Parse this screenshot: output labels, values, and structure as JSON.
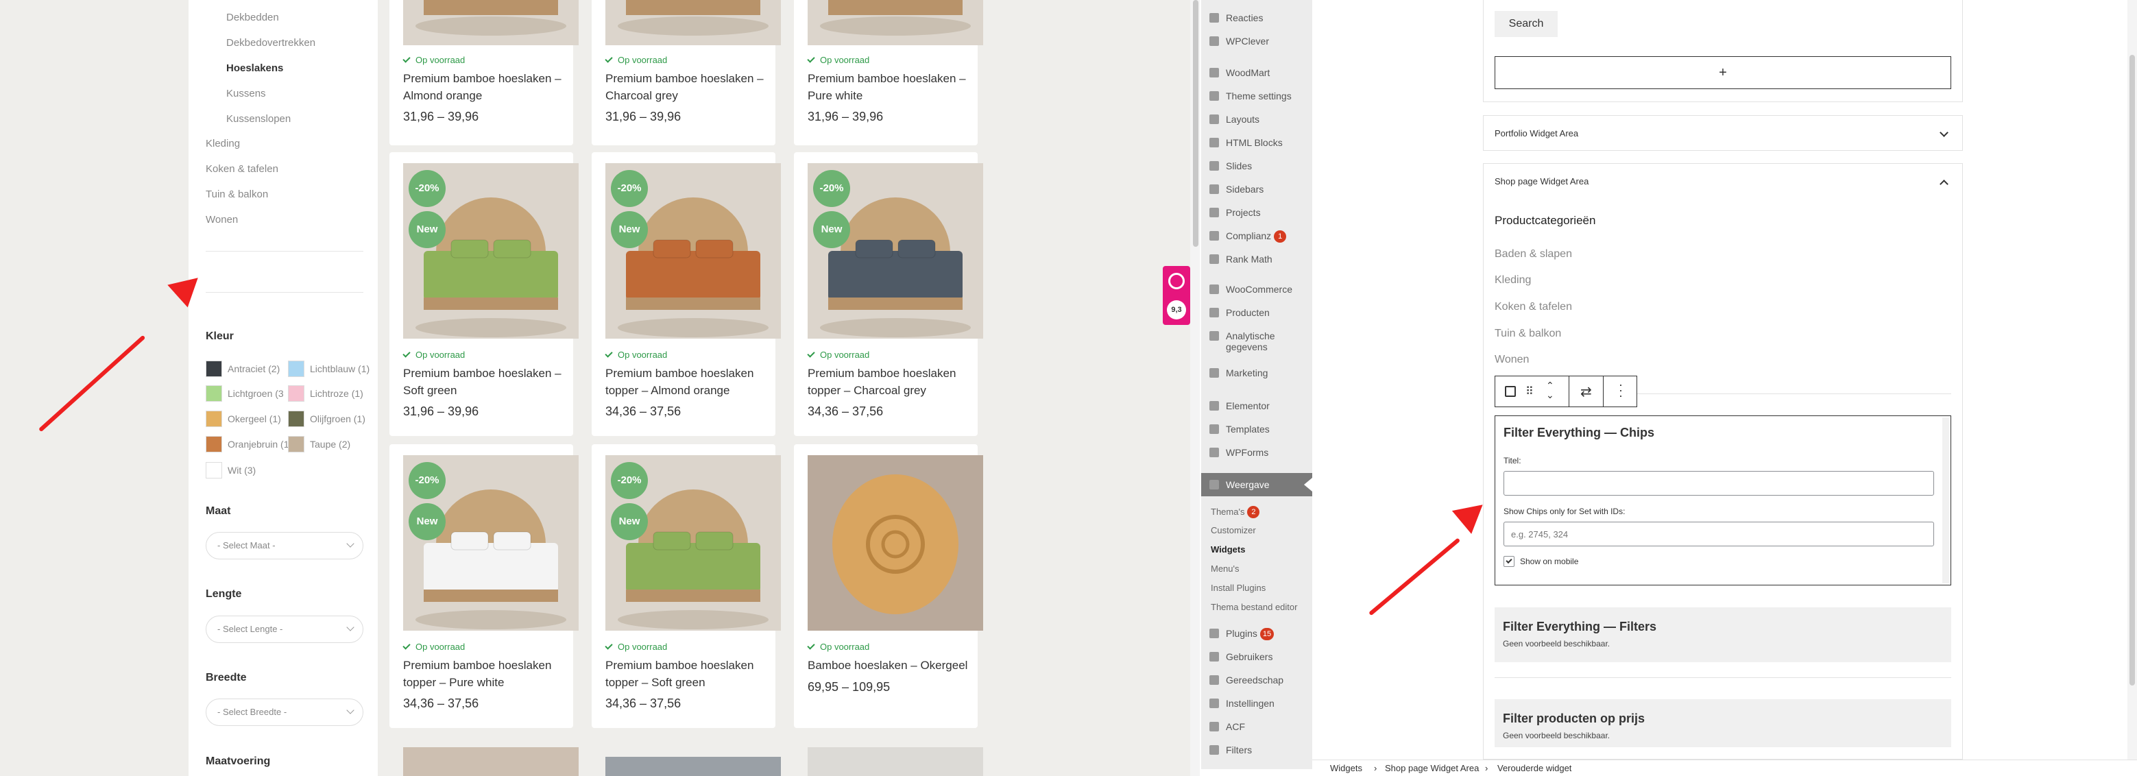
{
  "shop": {
    "subcategories": [
      "Dekbedden",
      "Dekbedovertrekken",
      "Hoeslakens",
      "Kussens",
      "Kussenslopen"
    ],
    "active_subcategory": "Hoeslakens",
    "categories": [
      "Kleding",
      "Koken & tafelen",
      "Tuin & balkon",
      "Wonen"
    ],
    "filters": {
      "color_title": "Kleur",
      "colors": [
        {
          "label": "Antraciet (2)",
          "color": "#3a3f44"
        },
        {
          "label": "Lichtblauw (1)",
          "color": "#a9d6f2"
        },
        {
          "label": "Lichtgroen (3",
          "color": "#a9d98b"
        },
        {
          "label": "Lichtroze (1)",
          "color": "#f6c1d0"
        },
        {
          "label": "Okergeel (1)",
          "color": "#e3b061"
        },
        {
          "label": "Olijfgroen (1)",
          "color": "#6b6d4f"
        },
        {
          "label": "Oranjebruin (1",
          "color": "#c97d44"
        },
        {
          "label": "Taupe (2)",
          "color": "#c3b19a"
        },
        {
          "label": "Wit (3)",
          "color": "#ffffff"
        }
      ],
      "maat_title": "Maat",
      "maat_placeholder": "- Select Maat -",
      "lengte_title": "Lengte",
      "lengte_placeholder": "- Select Lengte -",
      "breedte_title": "Breedte",
      "breedte_placeholder": "- Select Breedte -",
      "maatvoering_title": "Maatvoering"
    },
    "products": [
      {
        "name": "Premium bamboe hoeslaken – Almond orange",
        "price": "31,96 – 39,96",
        "stock": "Op voorraad",
        "badges": [],
        "color": "#c9895a"
      },
      {
        "name": "Premium bamboe hoeslaken – Charcoal grey",
        "price": "31,96 – 39,96",
        "stock": "Op voorraad",
        "badges": [],
        "color": "#55606a"
      },
      {
        "name": "Premium bamboe hoeslaken – Pure white",
        "price": "31,96 – 39,96",
        "stock": "Op voorraad",
        "badges": [],
        "color": "#f2f2f2"
      },
      {
        "name": "Premium bamboe hoeslaken – Soft green",
        "price": "31,96 – 39,96",
        "stock": "Op voorraad",
        "badges": [
          "-20%",
          "New"
        ],
        "color": "#8fb25a"
      },
      {
        "name": "Premium bamboe hoeslaken topper – Almond orange",
        "price": "34,36 – 37,56",
        "stock": "Op voorraad",
        "badges": [
          "-20%",
          "New"
        ],
        "color": "#bf6a37"
      },
      {
        "name": "Premium bamboe hoeslaken topper – Charcoal grey",
        "price": "34,36 – 37,56",
        "stock": "Op voorraad",
        "badges": [
          "-20%",
          "New"
        ],
        "color": "#4f5a66"
      },
      {
        "name": "Premium bamboe hoeslaken topper – Pure white",
        "price": "34,36 – 37,56",
        "stock": "Op voorraad",
        "badges": [
          "-20%",
          "New"
        ],
        "color": "#f4f4f4"
      },
      {
        "name": "Premium bamboe hoeslaken topper – Soft green",
        "price": "34,36 – 37,56",
        "stock": "Op voorraad",
        "badges": [
          "-20%",
          "New"
        ],
        "color": "#8db05a"
      },
      {
        "name": "Bamboe hoeslaken – Okergeel",
        "price": "69,95 – 109,95",
        "stock": "Op voorraad",
        "badges": [],
        "color": "#d9a560"
      }
    ],
    "floating_badge": "9,3"
  },
  "wp": {
    "menu": [
      {
        "label": "Reacties"
      },
      {
        "label": "WPClever"
      },
      {
        "label": "WoodMart"
      },
      {
        "label": "Theme settings"
      },
      {
        "label": "Layouts"
      },
      {
        "label": "HTML Blocks"
      },
      {
        "label": "Slides"
      },
      {
        "label": "Sidebars"
      },
      {
        "label": "Projects"
      },
      {
        "label": "Complianz",
        "bubble": "1"
      },
      {
        "label": "Rank Math"
      },
      {
        "label": "WooCommerce"
      },
      {
        "label": "Producten"
      },
      {
        "label": "Analytische gegevens"
      },
      {
        "label": "Marketing"
      },
      {
        "label": "Elementor"
      },
      {
        "label": "Templates"
      },
      {
        "label": "WPForms"
      },
      {
        "label": "Weergave"
      }
    ],
    "submenu": [
      {
        "label": "Thema's",
        "bubble": "2"
      },
      {
        "label": "Customizer"
      },
      {
        "label": "Widgets"
      },
      {
        "label": "Menu's"
      },
      {
        "label": "Install Plugins"
      },
      {
        "label": "Thema bestand editor"
      }
    ],
    "menu_after": [
      {
        "label": "Plugins",
        "bubble": "15"
      },
      {
        "label": "Gebruikers"
      },
      {
        "label": "Gereedschap"
      },
      {
        "label": "Instellingen"
      },
      {
        "label": "ACF"
      },
      {
        "label": "Filters"
      }
    ],
    "search_button": "Search",
    "add_block": "+",
    "portfolio_area": "Portfolio Widget Area",
    "shop_area": "Shop page Widget Area",
    "product_categories_title": "Productcategorieën",
    "product_categories": [
      "Baden & slapen",
      "Kleding",
      "Koken & tafelen",
      "Tuin & balkon",
      "Wonen"
    ],
    "chips_widget": {
      "title": "Filter Everything — Chips",
      "titel_label": "Titel:",
      "titel_value": "",
      "ids_label": "Show Chips only for Set with IDs:",
      "ids_placeholder": "e.g. 2745, 324",
      "mobile_label": "Show on mobile"
    },
    "filters_widget": {
      "title": "Filter Everything — Filters",
      "subtitle": "Geen voorbeeld beschikbaar."
    },
    "price_widget": {
      "title": "Filter producten op prijs",
      "subtitle": "Geen voorbeeld beschikbaar."
    },
    "breadcrumb": [
      "Widgets",
      "Shop page Widget Area",
      "Verouderde widget"
    ]
  }
}
